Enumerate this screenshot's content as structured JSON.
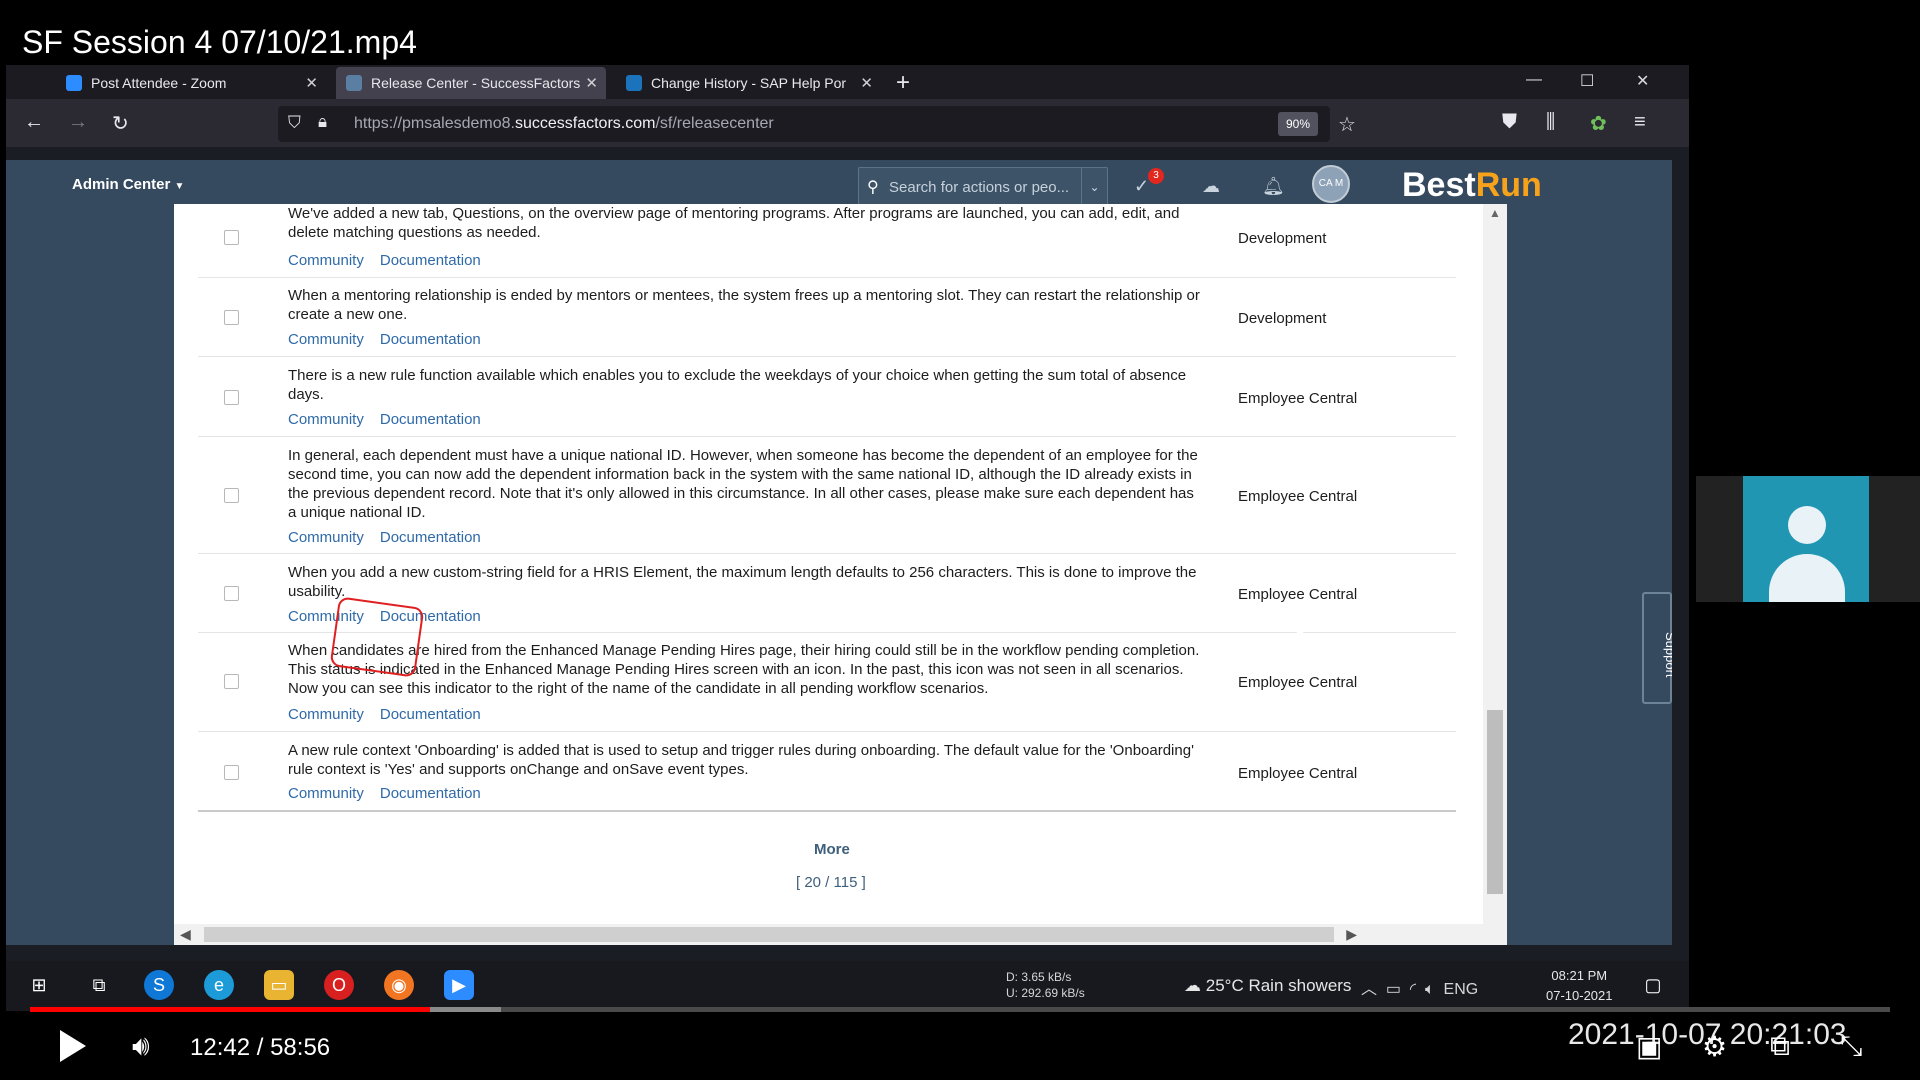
{
  "video": {
    "title": "SF Session 4 07/10/21.mp4",
    "current_time": "12:42",
    "separator": "/",
    "duration": "58:56",
    "progress_fraction": 0.215,
    "buffered_fraction": 0.253,
    "burned_in_timestamp": "2021-10-07 20:21:03"
  },
  "browser": {
    "tabs": [
      {
        "label": "Post Attendee - Zoom",
        "icon": "zoom-icon",
        "active": false
      },
      {
        "label": "Release Center - SuccessFactors",
        "icon": "successfactors-icon",
        "active": true
      },
      {
        "label": "Change History - SAP Help Por",
        "icon": "sap-icon",
        "active": false
      }
    ],
    "new_tab": "+",
    "url_prefix": "https://pmsalesdemo8.",
    "url_domain": "successfactors.com",
    "url_path": "/sf/releasecenter",
    "zoom": "90%"
  },
  "sf": {
    "menu": "Admin Center",
    "search_placeholder": "Search for actions or peo...",
    "notification_badge": "3",
    "avatar_initials": "CA M",
    "logo_best": "Best",
    "logo_run": "Run",
    "support": "Support",
    "link_community": "Community",
    "link_documentation": "Documentation",
    "rows": [
      {
        "text": "We've added a new tab, Questions, on the overview page of mentoring programs. After programs are launched, you can add, edit, and delete matching questions as needed.",
        "area": "Development"
      },
      {
        "text": "When a mentoring relationship is ended by mentors or mentees, the system frees up a mentoring slot. They can restart the relationship or create a new one.",
        "area": "Development"
      },
      {
        "text": "There is a new rule function available which enables you to exclude the weekdays of your choice when getting the sum total of absence days.",
        "area": "Employee Central"
      },
      {
        "text": "In general, each dependent must have a unique national ID. However, when someone has become the dependent of an employee for the second time, you can now add the dependent information back in the system with the same national ID, although the ID already exists in the previous dependent record. Note that it's only allowed in this circumstance. In all other cases, please make sure each dependent has a unique national ID.",
        "area": "Employee Central"
      },
      {
        "text": "When you add a new custom-string field for a HRIS Element, the maximum length defaults to 256 characters. This is done to improve the usability.",
        "area": "Employee Central"
      },
      {
        "text": "When candidates are hired from the Enhanced Manage Pending Hires page, their hiring could still be in the workflow pending completion. This status is indicated in the Enhanced Manage Pending Hires screen with an icon. In the past, this icon was not seen in all scenarios. Now you can see this indicator to the right of the name of the candidate in all pending workflow scenarios.",
        "area": "Employee Central"
      },
      {
        "text": "A new rule context 'Onboarding' is added that is used to setup and trigger rules during onboarding. The default value for the 'Onboarding' rule context is 'Yes' and supports onChange and onSave event types.",
        "area": "Employee Central"
      }
    ],
    "more": "More",
    "count": "[ 20 / 115 ]"
  },
  "taskbar": {
    "net_down": "D:     3.65 kB/s",
    "net_up": "U:  292.69 kB/s",
    "weather": "25°C  Rain showers",
    "lang": "ENG",
    "time": "08:21 PM",
    "date": "07-10-2021"
  }
}
